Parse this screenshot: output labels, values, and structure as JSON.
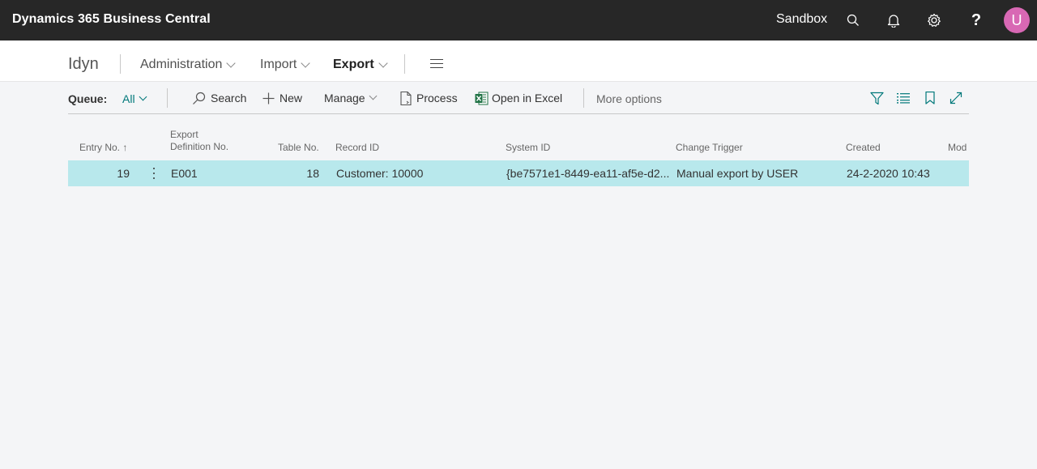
{
  "appbar": {
    "title": "Dynamics 365 Business Central",
    "environment": "Sandbox",
    "avatar_initial": "U"
  },
  "nav": {
    "company": "Idyn",
    "items": [
      {
        "label": "Administration"
      },
      {
        "label": "Import"
      },
      {
        "label": "Export"
      }
    ]
  },
  "actions": {
    "queue_label": "Queue:",
    "queue_value": "All",
    "search": "Search",
    "new": "New",
    "manage": "Manage",
    "process": "Process",
    "open_in_excel": "Open in Excel",
    "more_options": "More options"
  },
  "grid": {
    "columns": {
      "entry_no": "Entry No.",
      "sort_indicator": "↑",
      "export_def_line1": "Export",
      "export_def_line2": "Definition No.",
      "table_no": "Table No.",
      "record_id": "Record ID",
      "system_id": "System ID",
      "change_trigger": "Change Trigger",
      "created": "Created",
      "modified": "Mod"
    },
    "rows": [
      {
        "entry_no": "19",
        "export_definition_no": "E001",
        "table_no": "18",
        "record_id": "Customer: 10000",
        "system_id": "{be7571e1-8449-ea11-af5e-d2...",
        "change_trigger": "Manual export by USER",
        "created": "24-2-2020 10:43"
      }
    ]
  },
  "colors": {
    "appbar_bg": "#272727",
    "accent": "#00787a",
    "selected_row": "#b8e8ec",
    "avatar": "#d868b4",
    "excel_green": "#217346"
  }
}
